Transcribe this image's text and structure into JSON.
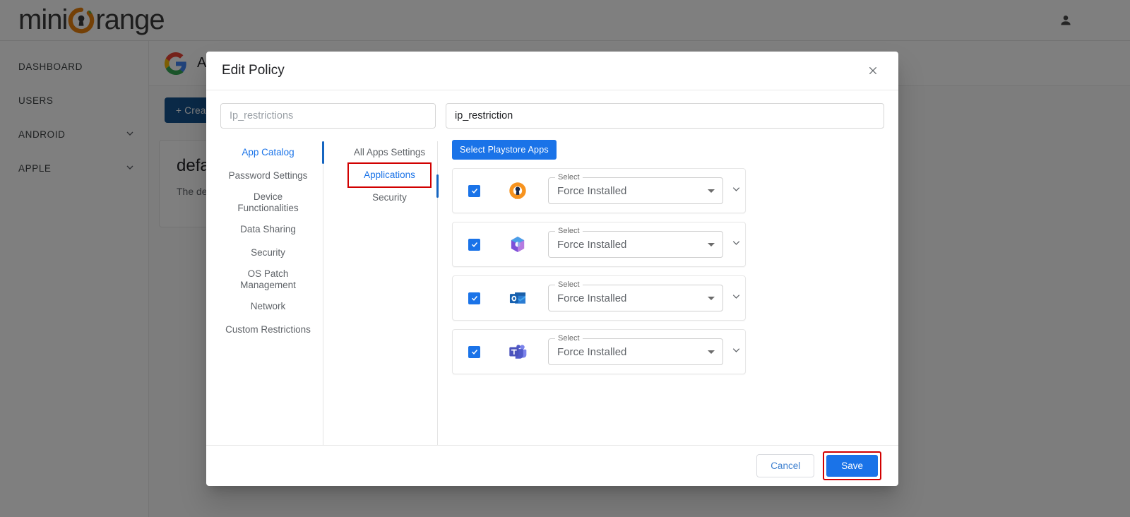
{
  "brand": {
    "name_part1": "mini",
    "name_part2": "range",
    "logo_orange": "#E8810C",
    "logo_dark": "#3A3A3A"
  },
  "topbar": {
    "account_icon": "person-icon"
  },
  "sidebar": {
    "items": [
      {
        "label": "DASHBOARD",
        "has_chevron": false
      },
      {
        "label": "USERS",
        "has_chevron": false
      },
      {
        "label": "ANDROID",
        "has_chevron": true
      },
      {
        "label": "APPLE",
        "has_chevron": true
      }
    ]
  },
  "background": {
    "page_title": "A",
    "create_button": "+ Create",
    "policy_card": {
      "title": "default",
      "description": "The defa"
    }
  },
  "modal": {
    "title": "Edit Policy",
    "close_icon": "close-icon",
    "fields": {
      "name_placeholder": "Ip_restrictions",
      "name_value": "",
      "description_value": "ip_restriction",
      "description_placeholder": ""
    },
    "tabs": [
      {
        "label": "App Catalog",
        "active": true
      },
      {
        "label": "Password Settings",
        "active": false
      },
      {
        "label": "Device Functionalities",
        "active": false
      },
      {
        "label": "Data Sharing",
        "active": false
      },
      {
        "label": "Security",
        "active": false
      },
      {
        "label": "OS Patch Management",
        "active": false
      },
      {
        "label": "Network",
        "active": false
      },
      {
        "label": "Custom Restrictions",
        "active": false
      }
    ],
    "subtabs": [
      {
        "label": "All Apps Settings",
        "active": false,
        "highlight": false
      },
      {
        "label": "Applications",
        "active": true,
        "highlight": true
      },
      {
        "label": "Security",
        "active": false,
        "highlight": false
      }
    ],
    "playstore_button": "Select Playstore Apps",
    "select_legend": "Select",
    "apps": [
      {
        "icon": "openvpn-icon",
        "checked": true,
        "install_mode": "Force Installed"
      },
      {
        "icon": "microsoft-365-icon",
        "checked": true,
        "install_mode": "Force Installed"
      },
      {
        "icon": "outlook-icon",
        "checked": true,
        "install_mode": "Force Installed"
      },
      {
        "icon": "microsoft-teams-icon",
        "checked": true,
        "install_mode": "Force Installed"
      }
    ],
    "footer": {
      "cancel_label": "Cancel",
      "save_label": "Save"
    }
  },
  "colors": {
    "accent_blue": "#1a73e8",
    "highlight_red": "#d10000",
    "active_tab_blue": "#1a73e8",
    "create_button_blue": "#14528f"
  }
}
